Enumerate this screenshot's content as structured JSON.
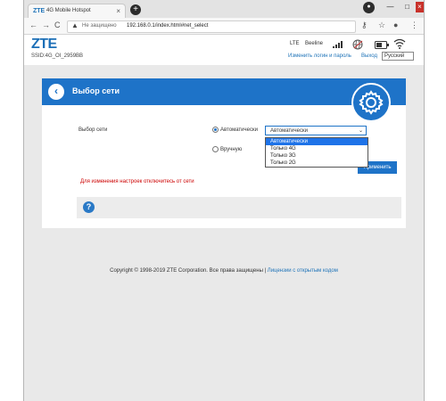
{
  "browser": {
    "tab_favicon": "ZTE",
    "tab_title": "4G Mobile Hotspot",
    "tab_close": "×",
    "new_tab": "+",
    "nav_back": "←",
    "nav_forward": "→",
    "nav_reload": "C",
    "warn_icon": "▲",
    "security_label": "Не защищено",
    "url": "192.168.0.1/index.html#net_select",
    "key_icon": "⚷",
    "star_icon": "☆",
    "menu_icon": "⋮",
    "profile_icon": "●",
    "minimize": "—",
    "maximize": "□",
    "close": "×"
  },
  "header": {
    "logo": "ZTE",
    "ssid": "SSID:4G_OI_2959BB",
    "network_type": "LTE",
    "operator": "Beeline",
    "change_login": "Изменить логин и пароль",
    "logout": "Выход",
    "language": "Русский",
    "icons": [
      "signal-icon",
      "globe-icon",
      "battery-icon",
      "wifi-icon"
    ]
  },
  "panel": {
    "back_symbol": "‹",
    "title": "Выбор сети",
    "field_label": "Выбор сети",
    "radio_auto": "Автоматически",
    "radio_manual": "Вручную",
    "select_value": "Автоматически",
    "select_chevron": "⌄",
    "options": [
      "Автоматически",
      "Только 4G",
      "Только 3G",
      "Только 2G"
    ],
    "apply": "Применить",
    "warning": "Для изменения настроек отключитесь от сети",
    "help_symbol": "?"
  },
  "footer": {
    "copyright": "Copyright © 1998-2019 ZTE Corporation. Все права защищены",
    "separator": "|",
    "license_link": "Лицензии с открытым кодом"
  },
  "colors": {
    "accent": "#1e73c8",
    "warning": "#cc0000",
    "highlight": "#1e73e8"
  }
}
